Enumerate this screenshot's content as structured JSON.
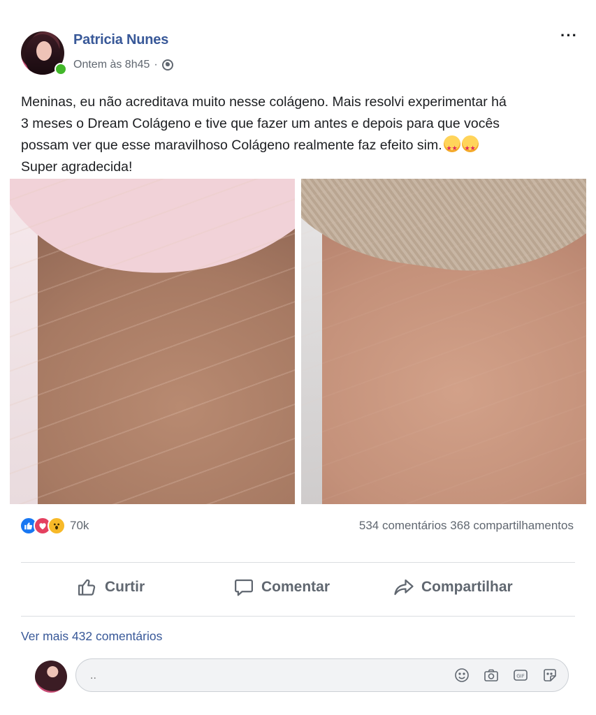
{
  "author": {
    "name": "Patricia Nunes",
    "timestamp": "Ontem às 8h45",
    "separator": "·",
    "online": true
  },
  "post": {
    "lines": [
      "Meninas, eu não acreditava muito nesse colágeno. Mais resolvi experimentar há",
      "3 meses o Dream Colágeno e tive que fazer um antes e depois para que vocês",
      "possam ver que esse maravilhoso Colágeno realmente faz efeito sim.",
      "Super agradecida!"
    ],
    "emojis": [
      "star-struck-emoji",
      "star-struck-emoji"
    ],
    "images": [
      "before-photo",
      "after-photo"
    ]
  },
  "stats": {
    "reactions": [
      "like",
      "love",
      "wow"
    ],
    "reaction_count": "70k",
    "comments": "534 comentários",
    "shares": "368 compartilhamentos"
  },
  "actions": {
    "like": "Curtir",
    "comment": "Comentar",
    "share": "Compartilhar"
  },
  "see_more_comments": "Ver mais 432 comentários",
  "composer": {
    "placeholder": "..",
    "icons": [
      "emoji-icon",
      "camera-icon",
      "gif-icon",
      "sticker-icon"
    ]
  },
  "colors": {
    "name_link": "#385898",
    "meta_text": "#606770",
    "like_blue": "#1877f2",
    "love_red": "#e4405f",
    "wow_yellow": "#f7b928",
    "online_green": "#42b72a"
  }
}
